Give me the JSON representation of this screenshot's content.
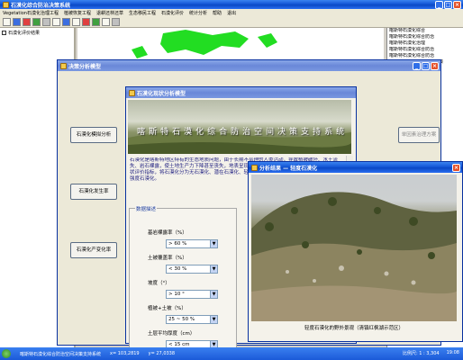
{
  "app": {
    "title": "石漠化综合防治决策系统",
    "menu": [
      "Vegetation石漠化治理工程",
      "植被恢复工程",
      "退耕还林还草",
      "生态移民工程",
      "石漠化评价",
      "统计分析",
      "帮助",
      "退出"
    ],
    "layer_label": "石漠化评价结果"
  },
  "right_panel": {
    "lines": [
      "喀斯特石漠化综合",
      "喀斯特石漠化综合防治",
      "喀斯特石漠化治理",
      "喀斯特石漠化综合防治",
      "喀斯特石漠化综合防治",
      "喀斯特石漠化综合防治决策",
      "喀斯特石漠化综合",
      "喀斯特石漠化综合防治",
      "喀斯特石漠化综合",
      "喀斯特石漠化",
      "喀斯特石漠化综合防治",
      "喀斯特石漠化综合",
      "喀斯特石漠化综合",
      "喀斯特石漠化",
      "喀斯特石漠化综合"
    ]
  },
  "analysis_window": {
    "title": "决策分析模型",
    "buttons": [
      "石漠化模拟分析",
      "石漠化发生率",
      "石漠化产变化率",
      "单因素治理方案"
    ]
  },
  "overview_window": {
    "title": "石漠化现状分析模型",
    "banner": "喀斯特石漠化综合防治空间决策支持系统",
    "description": "石漠化是喀斯特地区特有的生态地质问题，由于长期不合理的人类活动，导致植被破坏、水土流失、岩石裸露，使土地生产力下降甚至丧失，地表呈现类似荒漠化景观的土地退化过程。根据现状评价指标，将石漠化分为无石漠化、潜在石漠化、轻度石漠化、中度石漠化、强度石漠化、极强度石漠化。",
    "group_title": "数据描述",
    "fields": [
      {
        "label": "基岩裸露率（%）",
        "value": "> 60 %"
      },
      {
        "label": "土被覆盖率（%）",
        "value": "< 30 %"
      },
      {
        "label": "坡度（°）",
        "value": "> 10 °"
      },
      {
        "label": "植被+土被（%）",
        "value": "25 ~ 50 %"
      },
      {
        "label": "土层平均厚度（cm）",
        "value": "< 15 cm"
      }
    ]
  },
  "photo_window": {
    "title": "分析结果 — 轻度石漠化",
    "caption": "轻度石漠化的野外景观（清镇红枫湖示范区）"
  },
  "status": {
    "left": "喀斯特石漠化综合防治空间决策支持系统",
    "x": "x= 103,2819",
    "y": "y= 27,0338",
    "scale": "比例尺: 1 : 3,304",
    "time": "19:08"
  }
}
